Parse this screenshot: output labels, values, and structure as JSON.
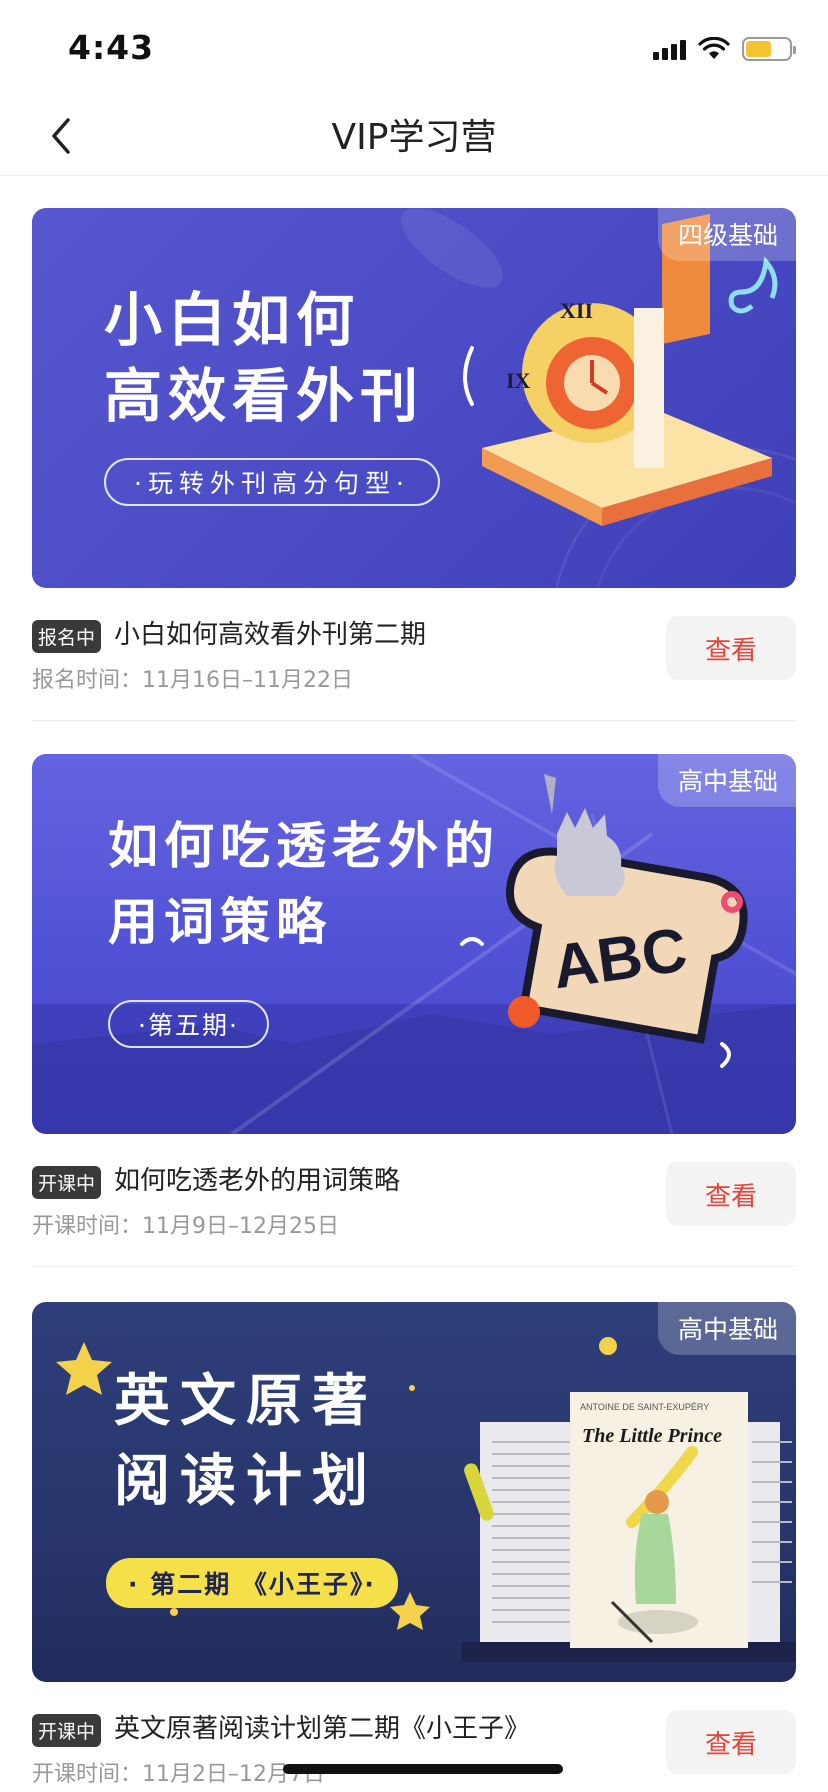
{
  "status_bar": {
    "time": "4:43",
    "battery_color": "#f6c433"
  },
  "nav": {
    "title": "VIP学习营",
    "back_icon": "chevron-left-icon"
  },
  "view_label": "查看",
  "colors": {
    "accent_red": "#e2453b",
    "badge_bg": "#3a3a3a"
  },
  "courses": [
    {
      "level_tag": "四级基础",
      "banner_title_line1": "小白如何",
      "banner_title_line2": "高效看外刊",
      "banner_subtitle": "·玩转外刊高分句型·",
      "status": "报名中",
      "title": "小白如何高效看外刊第二期",
      "date": "报名时间：11月16日–11月22日"
    },
    {
      "level_tag": "高中基础",
      "banner_title_line1": "如何吃透老外的",
      "banner_title_line2": "用词策略",
      "banner_subtitle": "·第五期·",
      "banner_graphic_text": "ABC",
      "status": "开课中",
      "title": "如何吃透老外的用词策略",
      "date": "开课时间：11月9日–12月25日"
    },
    {
      "level_tag": "高中基础",
      "banner_title_line1": "英文原著",
      "banner_title_line2": "阅读计划",
      "banner_subtitle": "· 第二期 《小王子》·",
      "book_author": "ANTOINE DE SAINT-EXUPÉRY",
      "book_title": "The Little Prince",
      "status": "开课中",
      "title": "英文原著阅读计划第二期《小王子》",
      "date": "开课时间：11月2日–12月7日"
    }
  ]
}
